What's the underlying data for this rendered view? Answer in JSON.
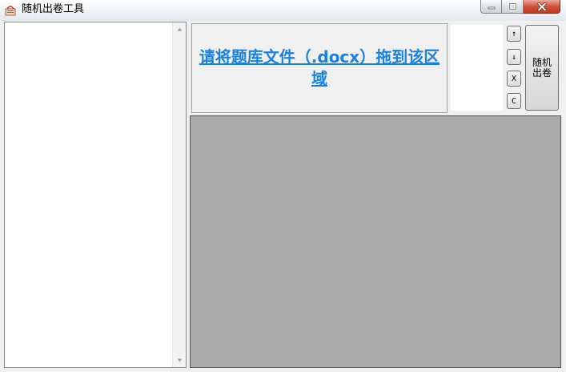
{
  "window": {
    "title": "随机出卷工具",
    "icon": "book-app-icon"
  },
  "window_controls": {
    "minimize_icon": "minimize-icon",
    "maximize_icon": "maximize-icon",
    "close_icon": "close-icon"
  },
  "drop_zone": {
    "text": "请将题库文件（.docx）拖到该区域"
  },
  "side_buttons": {
    "move_up": "↑",
    "move_down": "↓",
    "remove": "X",
    "clear": "C"
  },
  "generate_button": {
    "label": "随机出卷"
  },
  "colors": {
    "link": "#1a82e2",
    "preview_bg": "#ababab",
    "close_button": "#c43b22"
  }
}
